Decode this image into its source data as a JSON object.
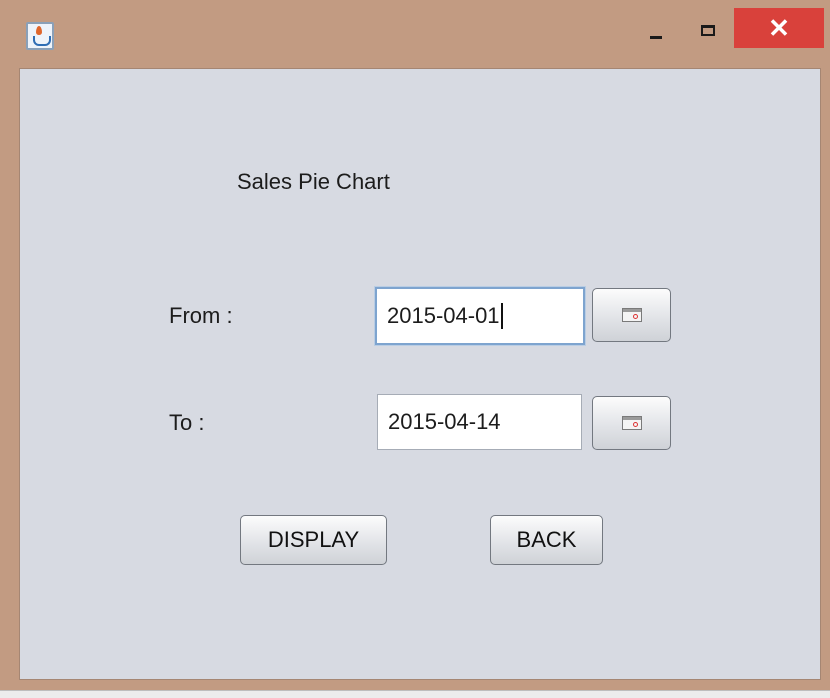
{
  "window": {
    "title": "",
    "icon": "java-cup-icon",
    "controls": {
      "minimize_icon": "minimize-icon",
      "maximize_icon": "maximize-icon",
      "close_glyph": "✕"
    },
    "colors": {
      "frame": "#c29b82",
      "close": "#d9413b",
      "client": "#d7dae2"
    }
  },
  "form": {
    "heading": "Sales Pie Chart",
    "from": {
      "label": "From :",
      "value": "2015-04-01",
      "calendar_icon": "calendar-icon"
    },
    "to": {
      "label": "To :",
      "value": "2015-04-14",
      "calendar_icon": "calendar-icon"
    },
    "buttons": {
      "display": "DISPLAY",
      "back": "BACK"
    }
  }
}
